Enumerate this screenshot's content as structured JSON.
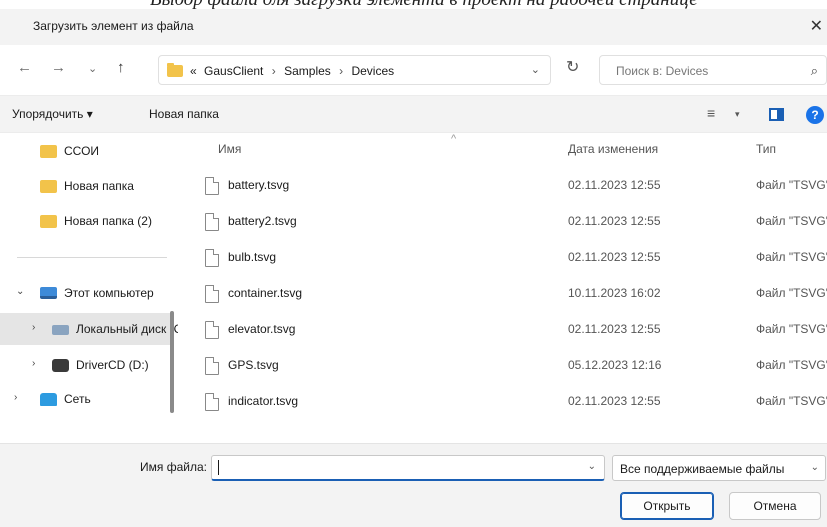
{
  "window": {
    "title": "Загрузить элемент из файла",
    "close_glyph": "✕"
  },
  "nav": {
    "back_glyph": "←",
    "forward_glyph": "→",
    "history_glyph": "⌄",
    "up_glyph": "↑",
    "breadcrumbs": [
      "«",
      "GausClient",
      "Samples",
      "Devices"
    ],
    "breadcrumb_sep": "›",
    "address_dropdown_glyph": "⌄",
    "refresh_glyph": "↻",
    "search_placeholder": "Поиск в: Devices",
    "search_glyph": "⌕"
  },
  "toolbar": {
    "organize_label": "Упорядочить ▾",
    "new_folder_label": "Новая папка",
    "view_glyph": "≡",
    "view_caret": "▾",
    "help_glyph": "?"
  },
  "sidebar": {
    "items": [
      {
        "label": "ССОИ",
        "icon": "folder-icon",
        "chevron": ""
      },
      {
        "label": "Новая папка",
        "icon": "folder-icon",
        "chevron": ""
      },
      {
        "label": "Новая папка (2)",
        "icon": "folder-icon",
        "chevron": ""
      },
      {
        "label": "Этот компьютер",
        "icon": "computer-icon",
        "chevron": "⌄"
      },
      {
        "label": "Локальный диск (C:)",
        "icon": "drive-icon",
        "chevron": "›",
        "selected": true
      },
      {
        "label": "DriverCD (D:)",
        "icon": "dvd-drive-icon",
        "chevron": "›"
      },
      {
        "label": "Сеть",
        "icon": "network-icon",
        "chevron": "›"
      }
    ]
  },
  "files": {
    "columns": {
      "name": "Имя",
      "date": "Дата изменения",
      "type": "Тип",
      "sort_glyph": "^"
    },
    "rows": [
      {
        "name": "battery.tsvg",
        "date": "02.11.2023 12:55",
        "type": "Файл \"TSVG\""
      },
      {
        "name": "battery2.tsvg",
        "date": "02.11.2023 12:55",
        "type": "Файл \"TSVG\""
      },
      {
        "name": "bulb.tsvg",
        "date": "02.11.2023 12:55",
        "type": "Файл \"TSVG\""
      },
      {
        "name": "container.tsvg",
        "date": "10.11.2023 16:02",
        "type": "Файл \"TSVG\""
      },
      {
        "name": "elevator.tsvg",
        "date": "02.11.2023 12:55",
        "type": "Файл \"TSVG\""
      },
      {
        "name": "GPS.tsvg",
        "date": "05.12.2023 12:16",
        "type": "Файл \"TSVG\""
      },
      {
        "name": "indicator.tsvg",
        "date": "02.11.2023 12:55",
        "type": "Файл \"TSVG\""
      }
    ]
  },
  "footer": {
    "filename_label": "Имя файла:",
    "filename_value": "",
    "filename_dropdown_glyph": "⌄",
    "filter_value": "Все поддерживаемые файлы",
    "filter_dropdown_glyph": "⌄",
    "open_label": "Открыть",
    "cancel_label": "Отмена"
  },
  "colors": {
    "accent": "#1a5fb4",
    "folder": "#f2c34a",
    "chrome": "#f3f3f3"
  }
}
